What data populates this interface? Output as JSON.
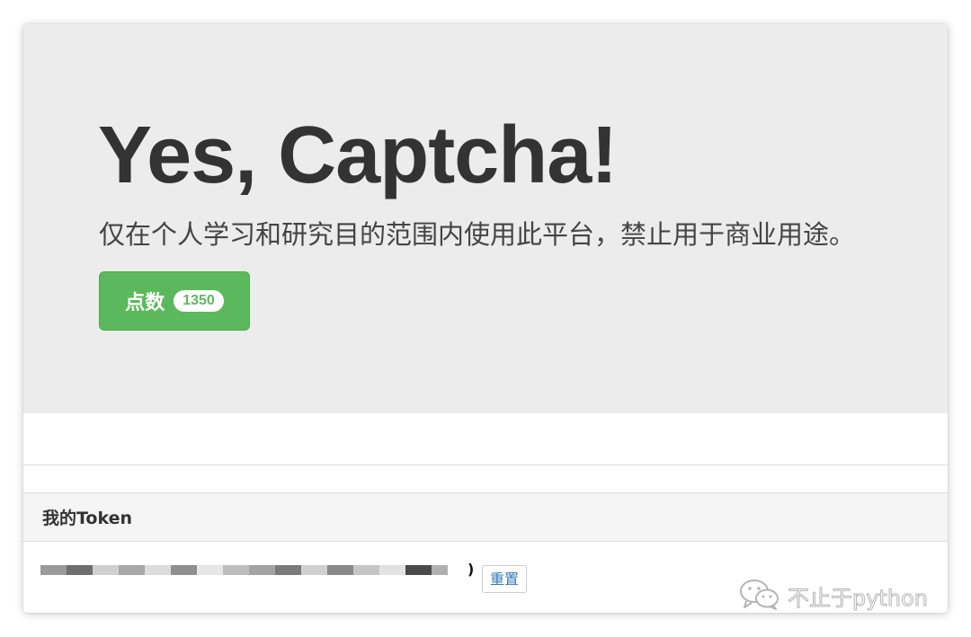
{
  "hero": {
    "title": "Yes, Captcha!",
    "subtitle": "仅在个人学习和研究目的范围内使用此平台，禁止用于商业用途。",
    "points_button": {
      "label": "点数",
      "count": "1350",
      "color": "#5cb85c"
    }
  },
  "token_panel": {
    "title": "我的Token",
    "token_masked_tail": ")",
    "reset_label": "重置"
  },
  "watermark": {
    "icon": "wechat-icon",
    "text": "不止于python"
  },
  "colors": {
    "jumbotron_bg": "#ececec",
    "success": "#5cb85c",
    "link": "#337ab7"
  }
}
